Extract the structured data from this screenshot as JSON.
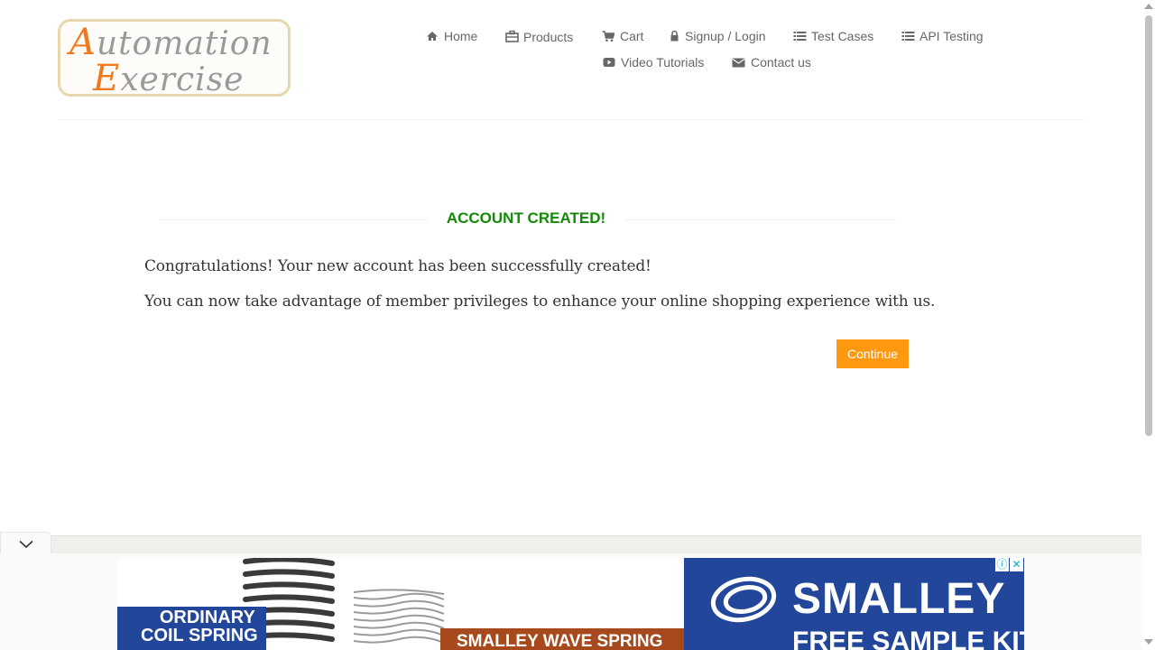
{
  "header": {
    "logo": {
      "line1": "Automation",
      "line2": "Exercise"
    },
    "nav": [
      {
        "label": "Home",
        "icon": "home-icon"
      },
      {
        "label": "Products",
        "icon": "briefcase-icon"
      },
      {
        "label": "Cart",
        "icon": "cart-icon"
      },
      {
        "label": "Signup / Login",
        "icon": "lock-icon"
      },
      {
        "label": "Test Cases",
        "icon": "list-icon"
      },
      {
        "label": "API Testing",
        "icon": "list-icon"
      },
      {
        "label": "Video Tutorials",
        "icon": "youtube-play-icon"
      },
      {
        "label": "Contact us",
        "icon": "envelope-icon"
      }
    ]
  },
  "main": {
    "title": "ACCOUNT CREATED!",
    "message1": "Congratulations! Your new account has been successfully created!",
    "message2": "You can now take advantage of member privileges to enhance your online shopping experience with us.",
    "continue_label": "Continue"
  },
  "ad": {
    "left_label_line1": "ORDINARY",
    "left_label_line2": "COIL SPRING",
    "middle_label": "SMALLEY WAVE SPRING",
    "brand": "SMALLEY",
    "tagline": "FREE SAMPLE KIT",
    "info_glyph": "ⓘ",
    "close_glyph": "✕"
  },
  "colors": {
    "accent": "#fe980f",
    "success": "#138a07",
    "logo_orange": "#f1791d",
    "ad_blue": "#22469a",
    "ad_orange": "#a64a1d"
  }
}
